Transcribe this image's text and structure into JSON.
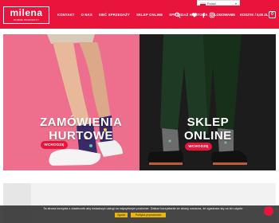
{
  "header": {
    "logo": {
      "name": "milena",
      "tagline": "DOBRE PRODUKTY"
    },
    "nav": [
      {
        "label": "KONTAKT"
      },
      {
        "label": "O NAS"
      },
      {
        "label": "SIEĆ SPRZEDAŻY"
      },
      {
        "label": "SKLEP ONLINE"
      },
      {
        "label": "SPRZEDAŻ HURTOWA"
      }
    ],
    "language": "Polski",
    "login_label": "LOGOWANIE",
    "cart_label": "KOSZYK / 0,00 ZŁ",
    "cart_count": "0"
  },
  "hero": {
    "left": {
      "title_line1": "ZAMÓWIENIA",
      "title_line2": "HURTOWE",
      "cta": "WCHODZĘ"
    },
    "right": {
      "title_line1": "SKLEP",
      "title_line2": "ONLINE",
      "cta": "WCHODZĘ"
    }
  },
  "cookie": {
    "text": "Ta strona korzysta z ciasteczek aby świadczyć usługi na najwyższym poziomie. Dalsze korzystanie ze strony oznacza, że zgadzasz się na ich użycie.",
    "ok_label": "Zgoda",
    "policy_label": "Polityka prywatności"
  },
  "colors": {
    "brand": "#e8143c",
    "left_panel": "#ee6f8d",
    "right_panel": "#1c1c1c",
    "cookie_button": "#f0b400"
  }
}
